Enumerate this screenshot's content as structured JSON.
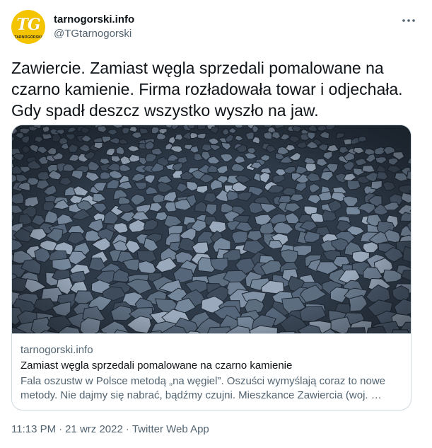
{
  "header": {
    "display_name": "tarnogorski.info",
    "handle": "@TGtarnogorski",
    "avatar_text": "TG",
    "avatar_subtext": "TARNOGÓRSKI",
    "more_icon": "more-horizontal-icon"
  },
  "tweet": {
    "text": "Zawiercie. Zamiast węgla sprzedali pomalowane na czarno kamienie. Firma rozładowała towar i odjechała. Gdy spadł deszcz wszystko wyszło na jaw."
  },
  "card": {
    "domain": "tarnogorski.info",
    "title": "Zamiast węgla sprzedali pomalowane na czarno kamienie",
    "description_line1": "Fala oszustw w Polsce metodą „na węgiel”. Oszuści wymyślają coraz to nowe",
    "description_line2": "metody. Nie dajmy się nabrać, bądźmy czujni. Mieszkance Zawiercia (woj. …"
  },
  "meta": {
    "time": "11:13 PM",
    "separator": "·",
    "date": "21 wrz 2022",
    "source": "Twitter Web App"
  },
  "colors": {
    "avatar_bg": "#f5c400",
    "text_primary": "#0f1419",
    "text_secondary": "#536471",
    "border": "#cfd9de"
  }
}
